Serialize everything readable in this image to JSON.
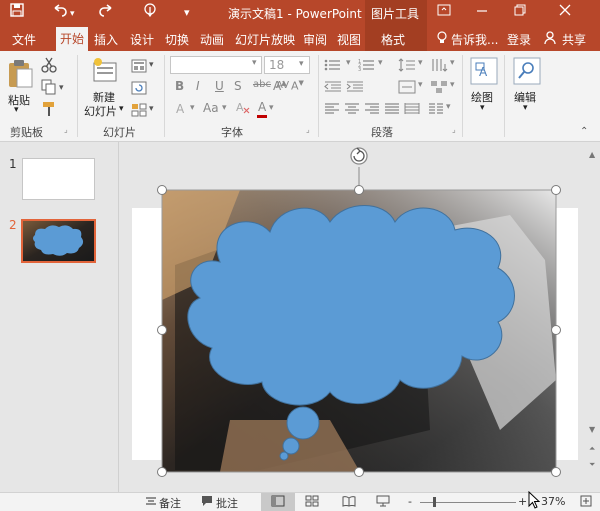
{
  "window": {
    "title": "演示文稿1 - PowerPoint",
    "context_tab_group": "图片工具"
  },
  "tabs": [
    "文件",
    "开始",
    "插入",
    "设计",
    "切换",
    "动画",
    "幻灯片放映",
    "审阅",
    "视图",
    "格式"
  ],
  "active_tab": "开始",
  "tell_me": "告诉我...",
  "login": "登录",
  "share": "共享",
  "ribbon": {
    "clipboard": {
      "paste": "粘贴",
      "group": "剪贴板"
    },
    "slides": {
      "new_slide_line1": "新建",
      "new_slide_line2": "幻灯片",
      "group": "幻灯片"
    },
    "font": {
      "font_name": "",
      "font_size": "18",
      "group": "字体",
      "bold": "B",
      "italic": "I",
      "underline": "U",
      "strike": "S",
      "shadow": "abc",
      "char_spacing": "AV",
      "case": "Aa",
      "font_color": "A"
    },
    "paragraph": {
      "group": "段落"
    },
    "drawing": {
      "label": "绘图"
    },
    "editing": {
      "label": "编辑"
    }
  },
  "slides": [
    {
      "number": "1",
      "selected": false
    },
    {
      "number": "2",
      "selected": true
    }
  ],
  "status": {
    "notes": "备注",
    "comments": "批注",
    "zoom": "37%",
    "zoom_minus": "-",
    "zoom_plus": "+"
  },
  "colors": {
    "accent": "#b7472a",
    "cloud_fill": "#5b9bd5",
    "cloud_stroke": "#41719c",
    "selection_border": "#e2643a"
  },
  "icons": [
    "save-icon",
    "undo-icon",
    "redo-icon",
    "touch-mode-icon",
    "customize-icon",
    "ribbon-display-icon",
    "minimize-icon",
    "restore-icon",
    "close-icon",
    "lightbulb-icon",
    "share-icon",
    "paste-icon",
    "cut-icon",
    "copy-icon",
    "format-painter-icon",
    "new-slide-icon",
    "layout-icon",
    "reset-icon",
    "section-icon",
    "bullets-icon",
    "numbering-icon",
    "indent-icon",
    "line-spacing-icon",
    "text-direction-icon",
    "align-text-icon",
    "smartart-icon",
    "align-left-icon",
    "center-icon",
    "align-right-icon",
    "justify-icon",
    "columns-icon",
    "drawing-icon",
    "find-icon",
    "rotate-handle-icon",
    "notes-icon",
    "comments-icon",
    "normal-view-icon",
    "slide-sorter-icon",
    "reading-view-icon",
    "slideshow-icon",
    "fit-to-window-icon"
  ]
}
